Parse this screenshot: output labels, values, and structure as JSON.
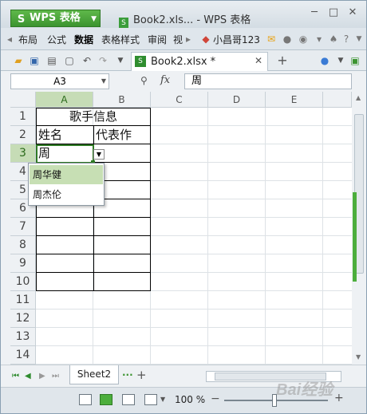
{
  "app": {
    "button_label": "WPS 表格",
    "logo": "S",
    "doc_title": "Book2.xls... - WPS 表格"
  },
  "menu": {
    "items": [
      "布局",
      "公式",
      "数据",
      "表格样式",
      "审阅",
      "视"
    ],
    "active": "数据",
    "user": "小昌哥123"
  },
  "tab": {
    "file_label": "Book2.xlsx *"
  },
  "formula": {
    "cell_ref": "A3",
    "fx": "fx",
    "content": "周"
  },
  "columns": [
    "A",
    "B",
    "C",
    "D",
    "E"
  ],
  "rows": [
    "1",
    "2",
    "3",
    "4",
    "5",
    "6",
    "7",
    "8",
    "9",
    "10",
    "11",
    "12",
    "13",
    "14"
  ],
  "cells": {
    "title": "歌手信息",
    "col_a_header": "姓名",
    "col_b_header": "代表作",
    "a3": "周"
  },
  "dropdown": {
    "options": [
      "周华健",
      "周杰伦"
    ],
    "highlighted_index": 0
  },
  "sheet": {
    "tab_label": "Sheet2",
    "more": "···",
    "add": "+"
  },
  "status": {
    "zoom": "100 %"
  },
  "watermark": "Bai经验",
  "colors": {
    "accent": "#4cae3c",
    "header_selected": "#c6dcb6",
    "dropdown_highlight": "#c7dfb4"
  },
  "icons": [
    "wps-logo-icon",
    "minimize-icon",
    "maximize-icon",
    "close-icon",
    "open-folder-icon",
    "save-icon",
    "print-icon",
    "preview-icon",
    "undo-icon",
    "redo-icon",
    "add-tab-icon",
    "search-icon",
    "dropdown-arrow-icon"
  ]
}
